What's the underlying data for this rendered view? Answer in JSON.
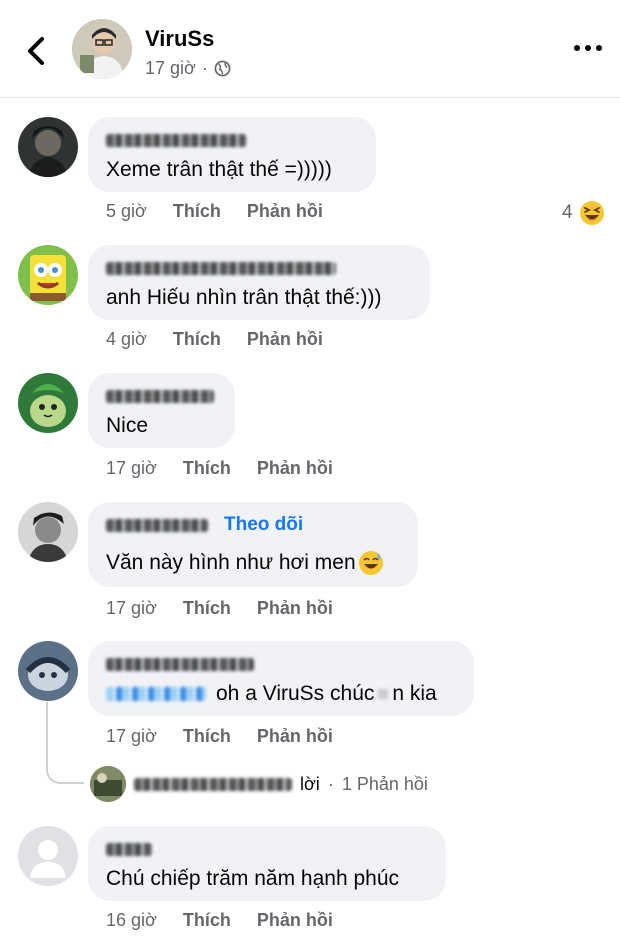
{
  "header": {
    "name": "ViruSs",
    "time": "17 giờ",
    "separator": "·"
  },
  "comments": [
    {
      "text": "Xeme trân thật thế =)))))",
      "time": "5 giờ",
      "like": "Thích",
      "reply": "Phản hồi",
      "reactions": "4"
    },
    {
      "text": "anh Hiếu nhìn trân thật thế:)))",
      "time": "4 giờ",
      "like": "Thích",
      "reply": "Phản hồi"
    },
    {
      "text": "Nice",
      "time": "17 giờ",
      "like": "Thích",
      "reply": "Phản hồi"
    },
    {
      "follow": "Theo dõi",
      "text": "Văn này hình như hơi men",
      "time": "17 giờ",
      "like": "Thích",
      "reply": "Phản hồi"
    },
    {
      "text": "oh a ViruSs chúc",
      "text_tail": "n kia",
      "time": "17 giờ",
      "like": "Thích",
      "reply": "Phản hồi"
    },
    {
      "text": "Chú chiếp trăm năm hạnh phúc",
      "time": "16 giờ",
      "like": "Thích",
      "reply": "Phản hồi"
    }
  ],
  "reply_summary": {
    "suffix": "lời",
    "separator": "·",
    "count_label": "1 Phản hồi"
  },
  "icons": {
    "back": "chevron-left-icon",
    "more": "more-horizontal-icon",
    "globe": "globe-icon",
    "reaction": "laughing-emoji-icon",
    "emoji": "sweat-smile-emoji-icon"
  },
  "colors": {
    "bubble": "#f0f2f5",
    "meta": "#65676b",
    "link": "#1877f2"
  }
}
